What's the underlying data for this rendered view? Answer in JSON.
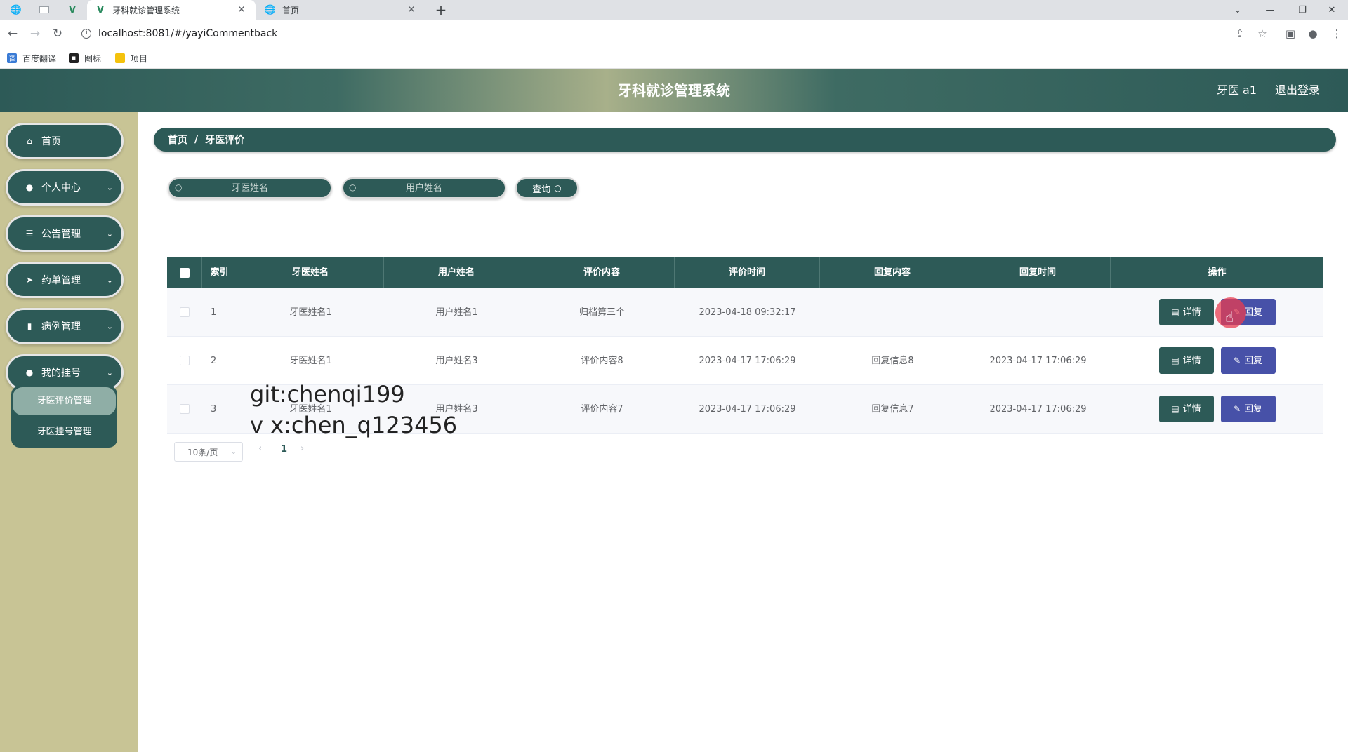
{
  "browser": {
    "tabs": [
      {
        "title": "牙科就诊管理系统",
        "active": true,
        "favicon": "vue-logo-icon"
      },
      {
        "title": "首页",
        "active": false,
        "favicon": "globe-icon"
      }
    ],
    "url": "localhost:8081/#/yayiCommentback",
    "bookmarks": [
      "百度翻译",
      "图标",
      "项目"
    ]
  },
  "header": {
    "title": "牙科就诊管理系统",
    "user": "牙医 a1",
    "logout": "退出登录"
  },
  "sidebar": {
    "items": [
      {
        "label": "首页",
        "icon": "home-icon"
      },
      {
        "label": "个人中心",
        "icon": "user-icon"
      },
      {
        "label": "公告管理",
        "icon": "list-icon"
      },
      {
        "label": "药单管理",
        "icon": "send-icon"
      },
      {
        "label": "病例管理",
        "icon": "bar-chart-icon"
      },
      {
        "label": "我的挂号",
        "icon": "location-icon"
      }
    ],
    "submenu": [
      "牙医评价管理",
      "牙医挂号管理"
    ]
  },
  "breadcrumb": {
    "home": "首页",
    "separator": "/",
    "current": "牙医评价"
  },
  "search": {
    "dentist_placeholder": "牙医姓名",
    "user_placeholder": "用户姓名",
    "query_label": "查询"
  },
  "table": {
    "headers": [
      "索引",
      "牙医姓名",
      "用户姓名",
      "评价内容",
      "评价时间",
      "回复内容",
      "回复时间",
      "操作"
    ],
    "rows": [
      {
        "index": "1",
        "dentist": "牙医姓名1",
        "user": "用户姓名1",
        "content": "归档第三个",
        "time": "2023-04-18 09:32:17",
        "reply": "",
        "reply_time": ""
      },
      {
        "index": "2",
        "dentist": "牙医姓名1",
        "user": "用户姓名3",
        "content": "评价内容8",
        "time": "2023-04-17 17:06:29",
        "reply": "回复信息8",
        "reply_time": "2023-04-17 17:06:29"
      },
      {
        "index": "3",
        "dentist": "牙医姓名1",
        "user": "用户姓名3",
        "content": "评价内容7",
        "time": "2023-04-17 17:06:29",
        "reply": "回复信息7",
        "reply_time": "2023-04-17 17:06:29"
      }
    ],
    "detail_label": "详情",
    "reply_label": "回复"
  },
  "pagination": {
    "page_size": "10条/页",
    "current_page": "1"
  },
  "watermark": {
    "line1": "git:chenqi199",
    "line2": "v x:chen_q123456"
  },
  "colors": {
    "primary": "#2d5a57",
    "reply_button": "#4751a8",
    "sidebar_bg": "#c8c495",
    "click_marker": "#e83c50"
  }
}
